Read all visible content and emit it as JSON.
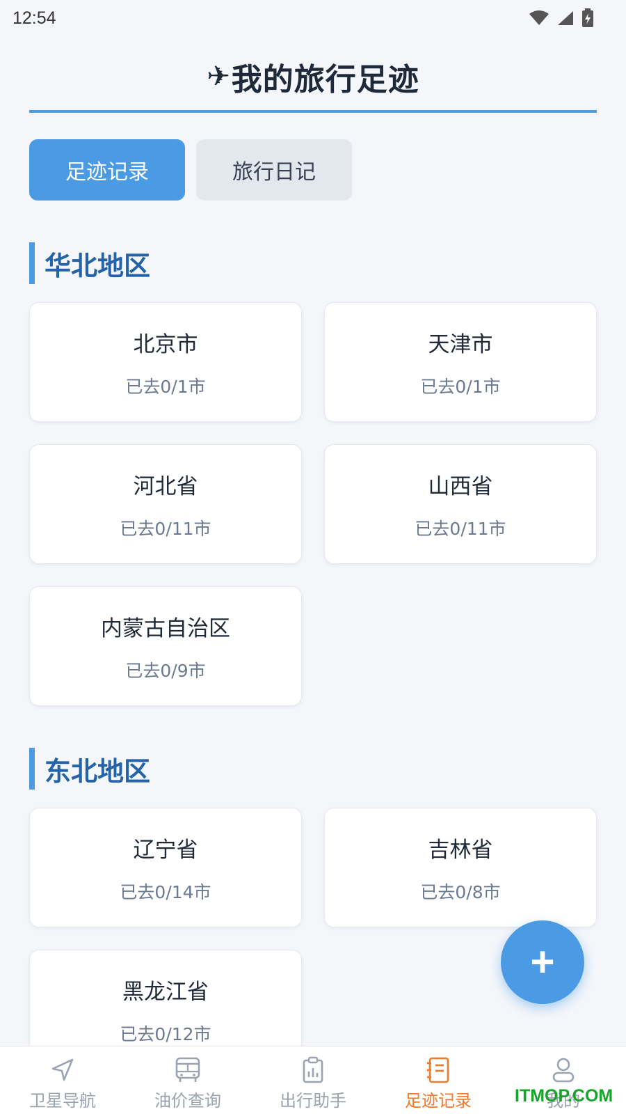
{
  "status_bar": {
    "time": "12:54"
  },
  "header": {
    "plane": "✈",
    "title": "我的旅行足迹"
  },
  "tabs": [
    {
      "label": "足迹记录",
      "active": true
    },
    {
      "label": "旅行日记",
      "active": false
    }
  ],
  "regions": [
    {
      "title": "华北地区",
      "provinces": [
        {
          "name": "北京市",
          "visited": "已去0/1市"
        },
        {
          "name": "天津市",
          "visited": "已去0/1市"
        },
        {
          "name": "河北省",
          "visited": "已去0/11市"
        },
        {
          "name": "山西省",
          "visited": "已去0/11市"
        },
        {
          "name": "内蒙古自治区",
          "visited": "已去0/9市"
        }
      ]
    },
    {
      "title": "东北地区",
      "provinces": [
        {
          "name": "辽宁省",
          "visited": "已去0/14市"
        },
        {
          "name": "吉林省",
          "visited": "已去0/8市"
        },
        {
          "name": "黑龙江省",
          "visited": "已去0/12市"
        }
      ]
    }
  ],
  "fab": {
    "label": "+"
  },
  "bottom_nav": [
    {
      "label": "卫星导航",
      "icon": "navigation-arrow-icon",
      "active": false
    },
    {
      "label": "油价查询",
      "icon": "bus-icon",
      "active": false
    },
    {
      "label": "出行助手",
      "icon": "clipboard-chart-icon",
      "active": false
    },
    {
      "label": "足迹记录",
      "icon": "notebook-icon",
      "active": true
    },
    {
      "label": "我的",
      "icon": "user-icon",
      "active": false
    }
  ],
  "watermark": "ITMOP.COM",
  "colors": {
    "accent": "#4a9be3",
    "region_title": "#2563a8",
    "nav_active": "#f07a2b"
  }
}
